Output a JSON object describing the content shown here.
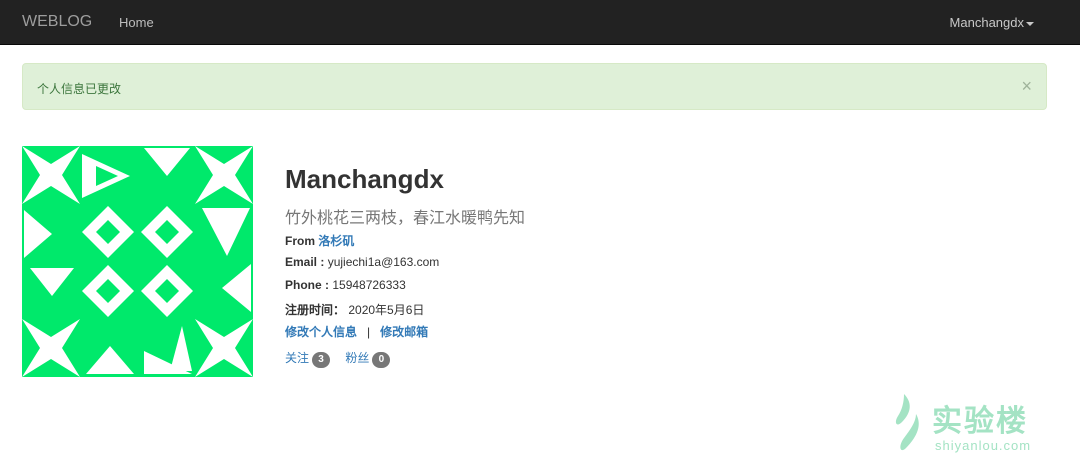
{
  "navbar": {
    "brand": "WEBLOG",
    "home": "Home",
    "user": "Manchangdx"
  },
  "alert": {
    "message": "个人信息已更改",
    "close": "×",
    "color": "#dff0d8"
  },
  "avatar": {
    "color": "#00e96b"
  },
  "profile": {
    "username": "Manchangdx",
    "motto": "竹外桃花三两枝，春江水暖鸭先知",
    "from_label": "From",
    "from_value": "洛杉矶",
    "email_label": "Email :",
    "email_value": "yujiechi1a@163.com",
    "phone_label": "Phone :",
    "phone_value": "15948726333",
    "registered_label": "注册时间：",
    "registered_value": "2020年5月6日",
    "edit_profile": "修改个人信息",
    "separator": "|",
    "edit_email": "修改邮箱",
    "following_label": "关注",
    "following_count": "3",
    "followers_label": "粉丝",
    "followers_count": "0"
  },
  "watermark": {
    "text": "实验楼",
    "sub": "shiyanlou.com"
  }
}
